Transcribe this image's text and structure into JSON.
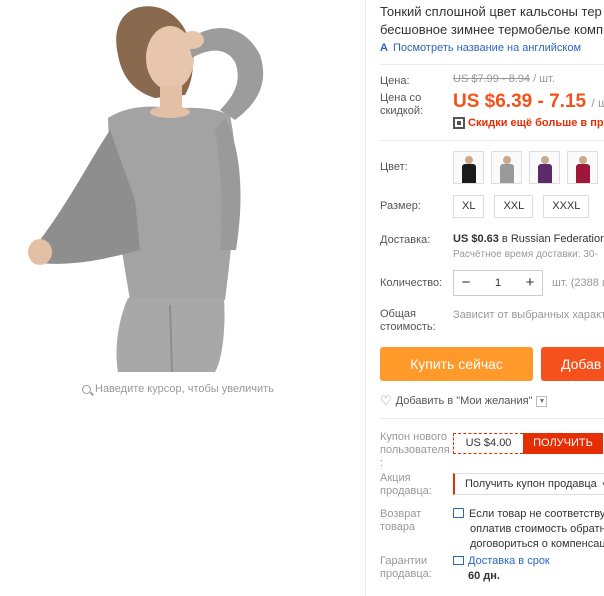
{
  "gallery": {
    "zoom_hint": "Наведите курсор, чтобы увеличить"
  },
  "product": {
    "title_line1": "Тонкий сплошной цвет кальсоны тер",
    "title_line2": "бесшовное зимнее термобелье комп",
    "translate_link": "Посмотреть название на английском"
  },
  "price": {
    "label": "Цена:",
    "old": "US $7.99 - 8.94",
    "old_unit": "/ шт.",
    "discount_label_line1": "Цена со",
    "discount_label_line2": "скидкой:",
    "new": "US $6.39 - 7.15",
    "new_unit": "/ шт",
    "more_discount": "Скидки ещё больше в прило"
  },
  "color": {
    "label": "Цвет:",
    "swatches": [
      {
        "name": "black",
        "color": "#1a1a1a"
      },
      {
        "name": "gray",
        "color": "#9a9a9a"
      },
      {
        "name": "purple",
        "color": "#5a2a6a"
      },
      {
        "name": "red",
        "color": "#a0153a"
      }
    ]
  },
  "size": {
    "label": "Размер:",
    "options": [
      "XL",
      "XXL",
      "XXXL"
    ]
  },
  "shipping": {
    "label": "Доставка:",
    "price": "US $0.63",
    "via": " в Russian Federation",
    "time": "Расчётное время доставки: 30-"
  },
  "quantity": {
    "label": "Количество:",
    "minus": "−",
    "value": "1",
    "plus": "+",
    "note": "шт. (2388 ш"
  },
  "total": {
    "label_line1": "Общая",
    "label_line2": "стоимость:",
    "note": "Зависит от выбранных характе"
  },
  "actions": {
    "buy_now": "Купить сейчас",
    "add_to_cart": "Добав",
    "wishlist": "Добавить в \"Мои желания\""
  },
  "coupon": {
    "label_line1": "Купон нового",
    "label_line2": "пользователя",
    "label_line3": ":",
    "value": "US $4.00",
    "get": "ПОЛУЧИТЬ"
  },
  "promo": {
    "label_line1": "Акция",
    "label_line2": "продавца:",
    "select": "Получить купон продавца"
  },
  "returns": {
    "label_line1": "Возврат",
    "label_line2": "товара",
    "line1": "Если товар не соответствует",
    "line2": "оплатив стоимость обратно",
    "line3": "договориться о компенсаци"
  },
  "guarantee": {
    "label_line1": "Гарантии",
    "label_line2": "продавца:",
    "delivery": "Доставка в срок",
    "days": "60 дн."
  },
  "colors": {
    "accent": "#f5511c",
    "buy": "#ff9a2a",
    "link": "#2a65c4",
    "coupon": "#e62e04"
  }
}
